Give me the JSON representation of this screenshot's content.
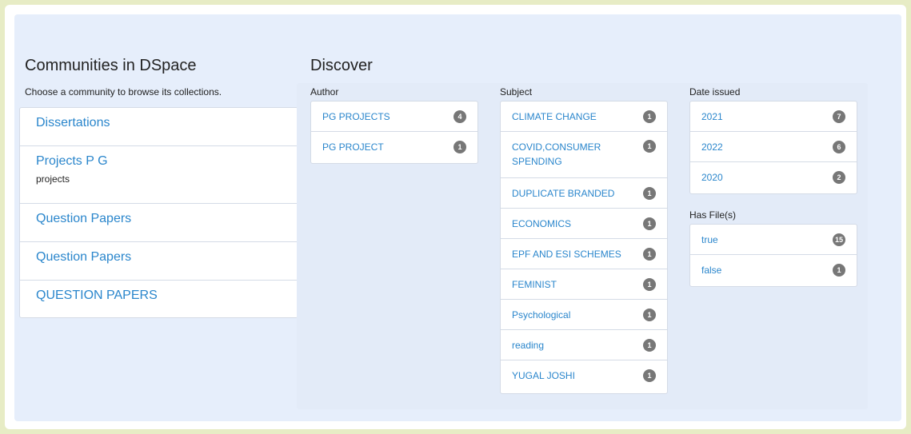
{
  "communities": {
    "title": "Communities in DSpace",
    "subtitle": "Choose a community to browse its collections.",
    "items": [
      {
        "label": "Dissertations",
        "description": ""
      },
      {
        "label": "Projects P G",
        "description": "projects"
      },
      {
        "label": "Question Papers",
        "description": ""
      },
      {
        "label": "Question Papers",
        "description": ""
      },
      {
        "label": "QUESTION PAPERS",
        "description": ""
      }
    ]
  },
  "discover": {
    "title": "Discover",
    "author": {
      "label": "Author",
      "items": [
        {
          "label": "PG PROJECTS",
          "count": "4"
        },
        {
          "label": "PG PROJECT",
          "count": "1"
        }
      ]
    },
    "subject": {
      "label": "Subject",
      "items": [
        {
          "label": "CLIMATE CHANGE",
          "count": "1"
        },
        {
          "label": "COVID,CONSUMER SPENDING",
          "count": "1"
        },
        {
          "label": "DUPLICATE BRANDED",
          "count": "1"
        },
        {
          "label": "ECONOMICS",
          "count": "1"
        },
        {
          "label": "EPF AND ESI SCHEMES",
          "count": "1"
        },
        {
          "label": "FEMINIST",
          "count": "1"
        },
        {
          "label": "Psychological",
          "count": "1"
        },
        {
          "label": "reading",
          "count": "1"
        },
        {
          "label": "YUGAL JOSHI",
          "count": "1"
        }
      ]
    },
    "date_issued": {
      "label": "Date issued",
      "items": [
        {
          "label": "2021",
          "count": "7"
        },
        {
          "label": "2022",
          "count": "6"
        },
        {
          "label": "2020",
          "count": "2"
        }
      ]
    },
    "has_files": {
      "label": "Has File(s)",
      "items": [
        {
          "label": "true",
          "count": "15"
        },
        {
          "label": "false",
          "count": "1"
        }
      ]
    }
  }
}
